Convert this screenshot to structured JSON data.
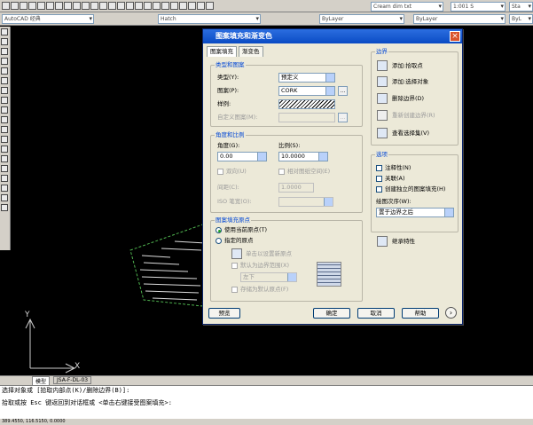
{
  "toolbar": {
    "text_style": "Cream dim txt",
    "scale": "1:001 S",
    "standard": "Sta",
    "workspace": "AutoCAD 经典",
    "layer": "Hatch",
    "color": "ByLayer",
    "linetype": "ByLayer",
    "lineweight": "ByL"
  },
  "layout_tabs": [
    "模型",
    "JSA-F-DL-03"
  ],
  "command_lines": [
    "选择对象或 [拾取内部点(K)/删除边界(B)]:",
    "拾取或按 Esc 键返回到对话框或 <单击右键接受图案填充>:"
  ],
  "status": {
    "coords": "389.4550, 116.5150, 0.0000"
  },
  "axes": {
    "y": "Y",
    "x": "X"
  },
  "dialog": {
    "title": "图案填充和渐变色",
    "tabs": [
      "图案填充",
      "渐变色"
    ],
    "type_group": {
      "title": "类型和图案",
      "type_label": "类型(Y):",
      "type_value": "预定义",
      "pattern_label": "图案(P):",
      "pattern_value": "CORK",
      "swatch_label": "样例:",
      "custom_label": "自定义图案(M):"
    },
    "angle_group": {
      "title": "角度和比例",
      "angle_label": "角度(G):",
      "angle_value": "0.00",
      "scale_label": "比例(S):",
      "scale_value": "10.0000",
      "double_label": "双向(U)",
      "relative_label": "相对图纸空间(E)",
      "spacing_label": "间距(C):",
      "spacing_value": "1.0000",
      "iso_label": "ISO 笔宽(O):"
    },
    "origin_group": {
      "title": "图案填充原点",
      "current_label": "使用当前原点(T)",
      "specified_label": "指定的原点",
      "click_label": "单击以设置新原点",
      "default_ext_label": "默认为边界范围(X)",
      "position_value": "左下",
      "store_label": "存储为默认原点(F)"
    },
    "boundary": {
      "title": "边界",
      "add_pick": "添加:拾取点",
      "add_select": "添加:选择对象",
      "remove": "删除边界(D)",
      "recreate": "重新创建边界(R)",
      "view": "查看选择集(V)"
    },
    "options": {
      "title": "选项",
      "annotative": "注释性(N)",
      "associative": "关联(A)",
      "separate": "创建独立的图案填充(H)",
      "draw_order_label": "绘图次序(W):",
      "draw_order_value": "置于边界之后"
    },
    "inherit": "继承特性",
    "buttons": {
      "preview": "预览",
      "ok": "确定",
      "cancel": "取消",
      "help": "帮助"
    }
  }
}
